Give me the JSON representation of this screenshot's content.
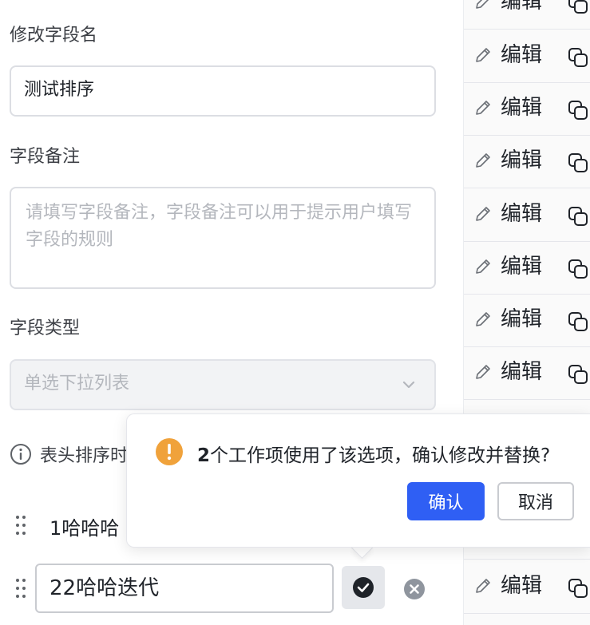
{
  "form": {
    "field_name_label": "修改字段名",
    "field_name_value": "测试排序",
    "remark_label": "字段备注",
    "remark_placeholder": "请填写字段备注，字段备注可以用于提示用户填写字段的规则",
    "type_label": "字段类型",
    "type_value": "单选下拉列表",
    "sort_hint": "表头排序时",
    "options": [
      {
        "label": "1哈哈哈"
      },
      {
        "label": "22哈哈迭代",
        "editing": true
      }
    ]
  },
  "popover": {
    "count": "2",
    "message": "个工作项使用了该选项，确认修改并替换?",
    "confirm_label": "确认",
    "cancel_label": "取消"
  },
  "right_column": {
    "edit_label": "编辑",
    "row_count": 11
  },
  "colors": {
    "primary": "#2f5ff4",
    "warning": "#f0a23b",
    "border": "#dcdee3",
    "text": "#1f2329"
  }
}
